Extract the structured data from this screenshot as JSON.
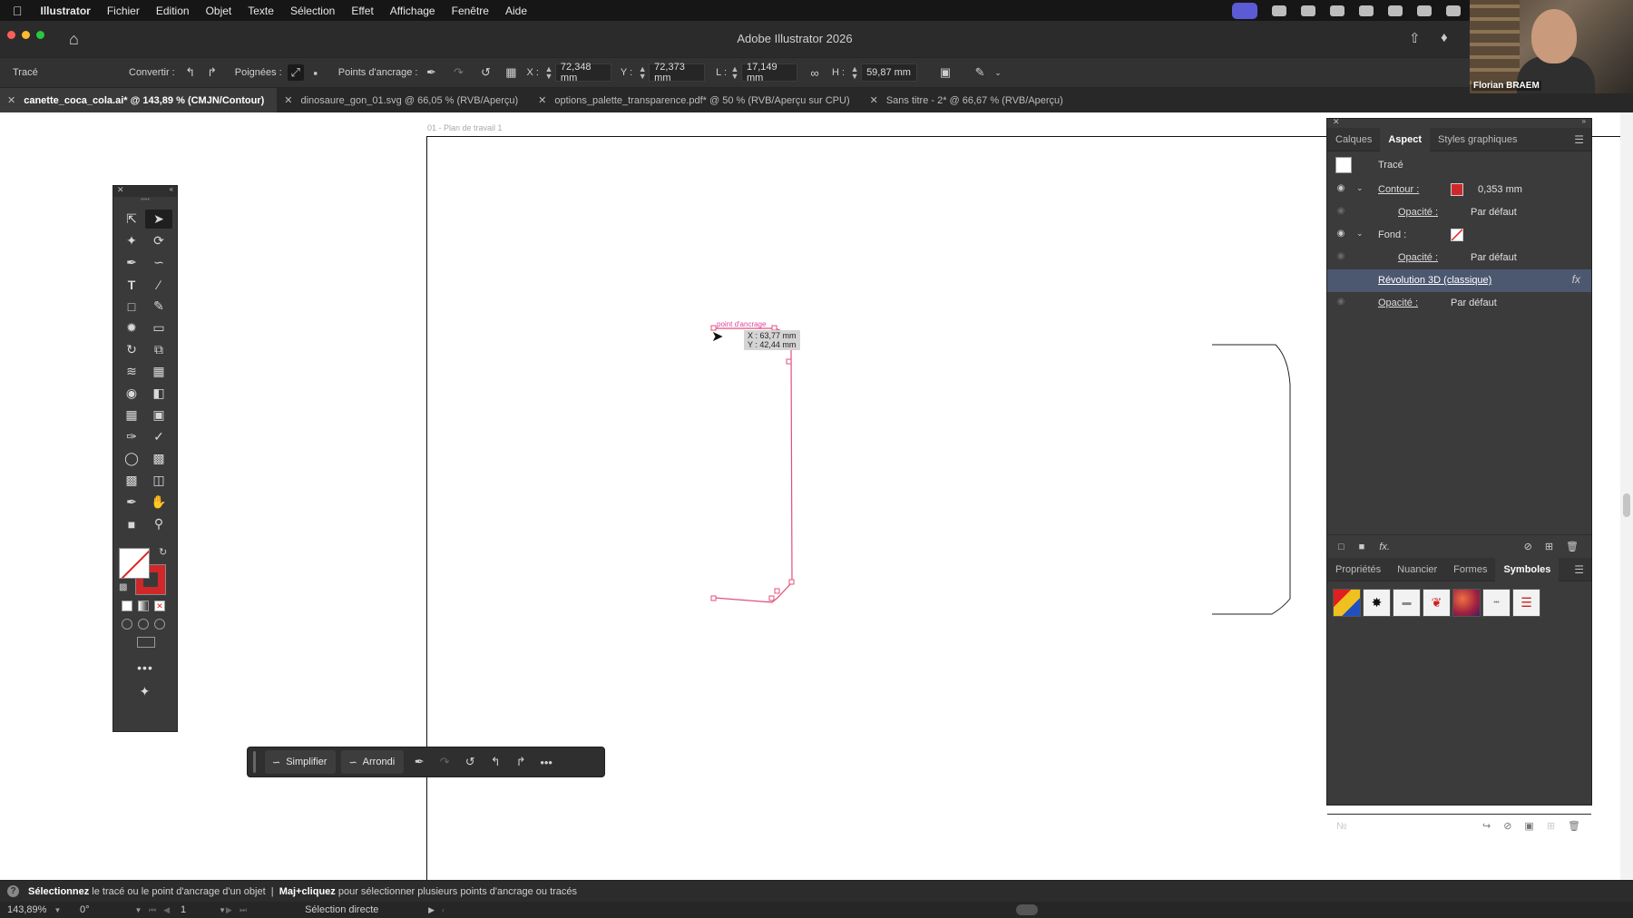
{
  "menubar": {
    "apple": "",
    "app_name": "Illustrator",
    "menus": [
      "Fichier",
      "Edition",
      "Objet",
      "Texte",
      "Sélection",
      "Effet",
      "Affichage",
      "Fenêtre",
      "Aide"
    ]
  },
  "webcam": {
    "name": "Florian BRAEM"
  },
  "window": {
    "title": "Adobe Illustrator 2026"
  },
  "control_bar": {
    "object_type": "Tracé",
    "convertir_label": "Convertir :",
    "poignees_label": "Poignées :",
    "points_label": "Points d'ancrage :",
    "x_label": "X :",
    "x_value": "72,348 mm",
    "y_label": "Y :",
    "y_value": "72,373 mm",
    "l_label": "L :",
    "l_value": "17,149 mm",
    "h_label": "H :",
    "h_value": "59,87 mm"
  },
  "tabs": [
    {
      "label": "canette_coca_cola.ai* @ 143,89 % (CMJN/Contour)",
      "active": true
    },
    {
      "label": "dinosaure_gon_01.svg @ 66,05 % (RVB/Aperçu)",
      "active": false
    },
    {
      "label": "options_palette_transparence.pdf* @ 50 % (RVB/Aperçu sur CPU)",
      "active": false
    },
    {
      "label": "Sans titre - 2* @ 66,67 % (RVB/Aperçu)",
      "active": false
    }
  ],
  "canvas": {
    "artboard_label": "01 - Plan de travail 1",
    "anchor_hint": "point d'ancrage",
    "tooltip_x": "X : 63,77 mm",
    "tooltip_y": "Y : 42,44 mm"
  },
  "taskbar": {
    "simplify_label": "Simplifier",
    "round_label": "Arrondi"
  },
  "aspect_panel": {
    "tabs": [
      "Calques",
      "Aspect",
      "Styles graphiques"
    ],
    "active_tab": "Aspect",
    "target": "Tracé",
    "contour_label": "Contour :",
    "contour_value": "0,353 mm",
    "contour_color": "#d0282a",
    "opacity_label": "Opacité :",
    "opacity_value": "Par défaut",
    "fond_label": "Fond :",
    "effect_label": "Révolution 3D (classique)",
    "fx_label": "fx"
  },
  "lower_panel": {
    "tabs": [
      "Propriétés",
      "Nuancier",
      "Formes",
      "Symboles"
    ],
    "active_tab": "Symboles"
  },
  "status": {
    "msg_bold1": "Sélectionnez",
    "msg1": " le tracé ou le point d'ancrage d'un objet  |  ",
    "msg_bold2": "Maj+cliquez",
    "msg2": " pour sélectionner plusieurs points d'ancrage ou tracés",
    "zoom": "143,89%",
    "rotation": "0°",
    "artboard_num": "1",
    "tool_name": "Sélection directe"
  },
  "colors": {
    "path_accent": "#e0507a",
    "selection_blue": "#4c5770"
  }
}
